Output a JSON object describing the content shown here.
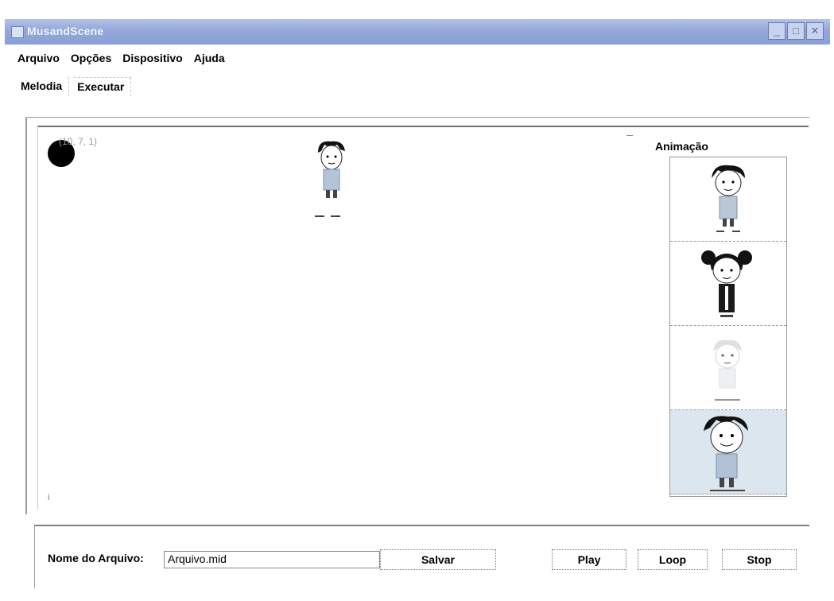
{
  "window": {
    "title": "MusandScene"
  },
  "menu": [
    "Arquivo",
    "Opções",
    "Dispositivo",
    "Ajuda"
  ],
  "tabs": [
    {
      "label": "Melodia",
      "selected": false
    },
    {
      "label": "Executar",
      "selected": true
    }
  ],
  "scene": {
    "coord_text": "(10, 7, 1)",
    "corner_mark": "i"
  },
  "animation": {
    "title": "Animação",
    "items": [
      {
        "name": "boy-character",
        "selected": false
      },
      {
        "name": "girl-character",
        "selected": false
      },
      {
        "name": "faded-character",
        "selected": false
      },
      {
        "name": "boy-character-alt",
        "selected": true
      }
    ]
  },
  "footer": {
    "file_label": "Nome do Arquivo:",
    "file_value": "Arquivo.mid",
    "save_label": "Salvar",
    "play_label": "Play",
    "loop_label": "Loop",
    "stop_label": "Stop"
  },
  "colors": {
    "titlebar": "#93a7d9",
    "selected_cell": "#dce6ef"
  }
}
